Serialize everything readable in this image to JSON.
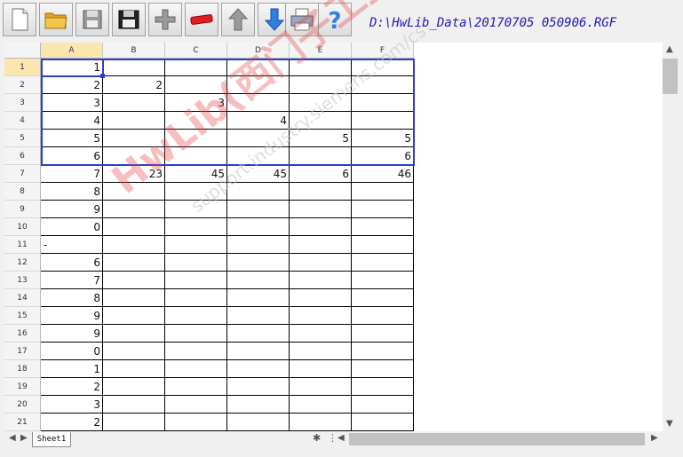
{
  "toolbar": {
    "buttons": [
      {
        "name": "new-file-button",
        "icon": "blank-page-icon"
      },
      {
        "name": "open-folder-button",
        "icon": "folder-icon"
      },
      {
        "name": "save-button",
        "icon": "floppy-disk-icon"
      },
      {
        "name": "save-as-button",
        "icon": "floppy-disk-double-icon"
      },
      {
        "name": "add-row-button",
        "icon": "plus-icon"
      },
      {
        "name": "delete-row-button",
        "icon": "minus-icon"
      },
      {
        "name": "move-up-button",
        "icon": "arrow-up-icon"
      },
      {
        "name": "move-down-button",
        "icon": "arrow-down-icon"
      },
      {
        "name": "print-button",
        "icon": "printer-icon"
      },
      {
        "name": "help-button",
        "icon": "question-icon"
      }
    ],
    "file_path": "D:\\HwLib_Data\\20170705 050906.RGF"
  },
  "sheet": {
    "columns": [
      "A",
      "B",
      "C",
      "D",
      "E",
      "F"
    ],
    "rows": [
      {
        "n": "1",
        "cells": [
          "1",
          "",
          "",
          "",
          "",
          ""
        ]
      },
      {
        "n": "2",
        "cells": [
          "2",
          "2",
          "",
          "",
          "",
          ""
        ]
      },
      {
        "n": "3",
        "cells": [
          "3",
          "",
          "3",
          "",
          "",
          ""
        ]
      },
      {
        "n": "4",
        "cells": [
          "4",
          "",
          "",
          "4",
          "",
          ""
        ]
      },
      {
        "n": "5",
        "cells": [
          "5",
          "",
          "",
          "",
          "5",
          "5"
        ]
      },
      {
        "n": "6",
        "cells": [
          "6",
          "",
          "",
          "",
          "",
          "6"
        ]
      },
      {
        "n": "7",
        "cells": [
          "7",
          "23",
          "45",
          "45",
          "6",
          "46"
        ]
      },
      {
        "n": "8",
        "cells": [
          "8",
          "",
          "",
          "",
          "",
          ""
        ]
      },
      {
        "n": "9",
        "cells": [
          "9",
          "",
          "",
          "",
          "",
          ""
        ]
      },
      {
        "n": "10",
        "cells": [
          "0",
          "",
          "",
          "",
          "",
          ""
        ]
      },
      {
        "n": "11",
        "cells": [
          "-",
          "",
          "",
          "",
          "",
          ""
        ]
      },
      {
        "n": "12",
        "cells": [
          "6",
          "",
          "",
          "",
          "",
          ""
        ]
      },
      {
        "n": "13",
        "cells": [
          "7",
          "",
          "",
          "",
          "",
          ""
        ]
      },
      {
        "n": "14",
        "cells": [
          "8",
          "",
          "",
          "",
          "",
          ""
        ]
      },
      {
        "n": "15",
        "cells": [
          "9",
          "",
          "",
          "",
          "",
          ""
        ]
      },
      {
        "n": "16",
        "cells": [
          "9",
          "",
          "",
          "",
          "",
          ""
        ]
      },
      {
        "n": "17",
        "cells": [
          "0",
          "",
          "",
          "",
          "",
          ""
        ]
      },
      {
        "n": "18",
        "cells": [
          "1",
          "",
          "",
          "",
          "",
          ""
        ]
      },
      {
        "n": "19",
        "cells": [
          "2",
          "",
          "",
          "",
          "",
          ""
        ]
      },
      {
        "n": "20",
        "cells": [
          "3",
          "",
          "",
          "",
          "",
          ""
        ]
      },
      {
        "n": "21",
        "cells": [
          "2",
          "",
          "",
          "",
          "",
          ""
        ]
      }
    ],
    "active_cell": "A1",
    "selection": "A1:F6"
  },
  "tabs": {
    "sheet_tab": "Sheet1"
  },
  "watermark": {
    "line1": "HwLib(西门子工业技术论坛",
    "line2": "support.industry.siemens.com/cs"
  },
  "colors": {
    "selection": "#2b3fc8",
    "path_text": "#1a1ab8",
    "header_active": "#fbe6b0"
  }
}
